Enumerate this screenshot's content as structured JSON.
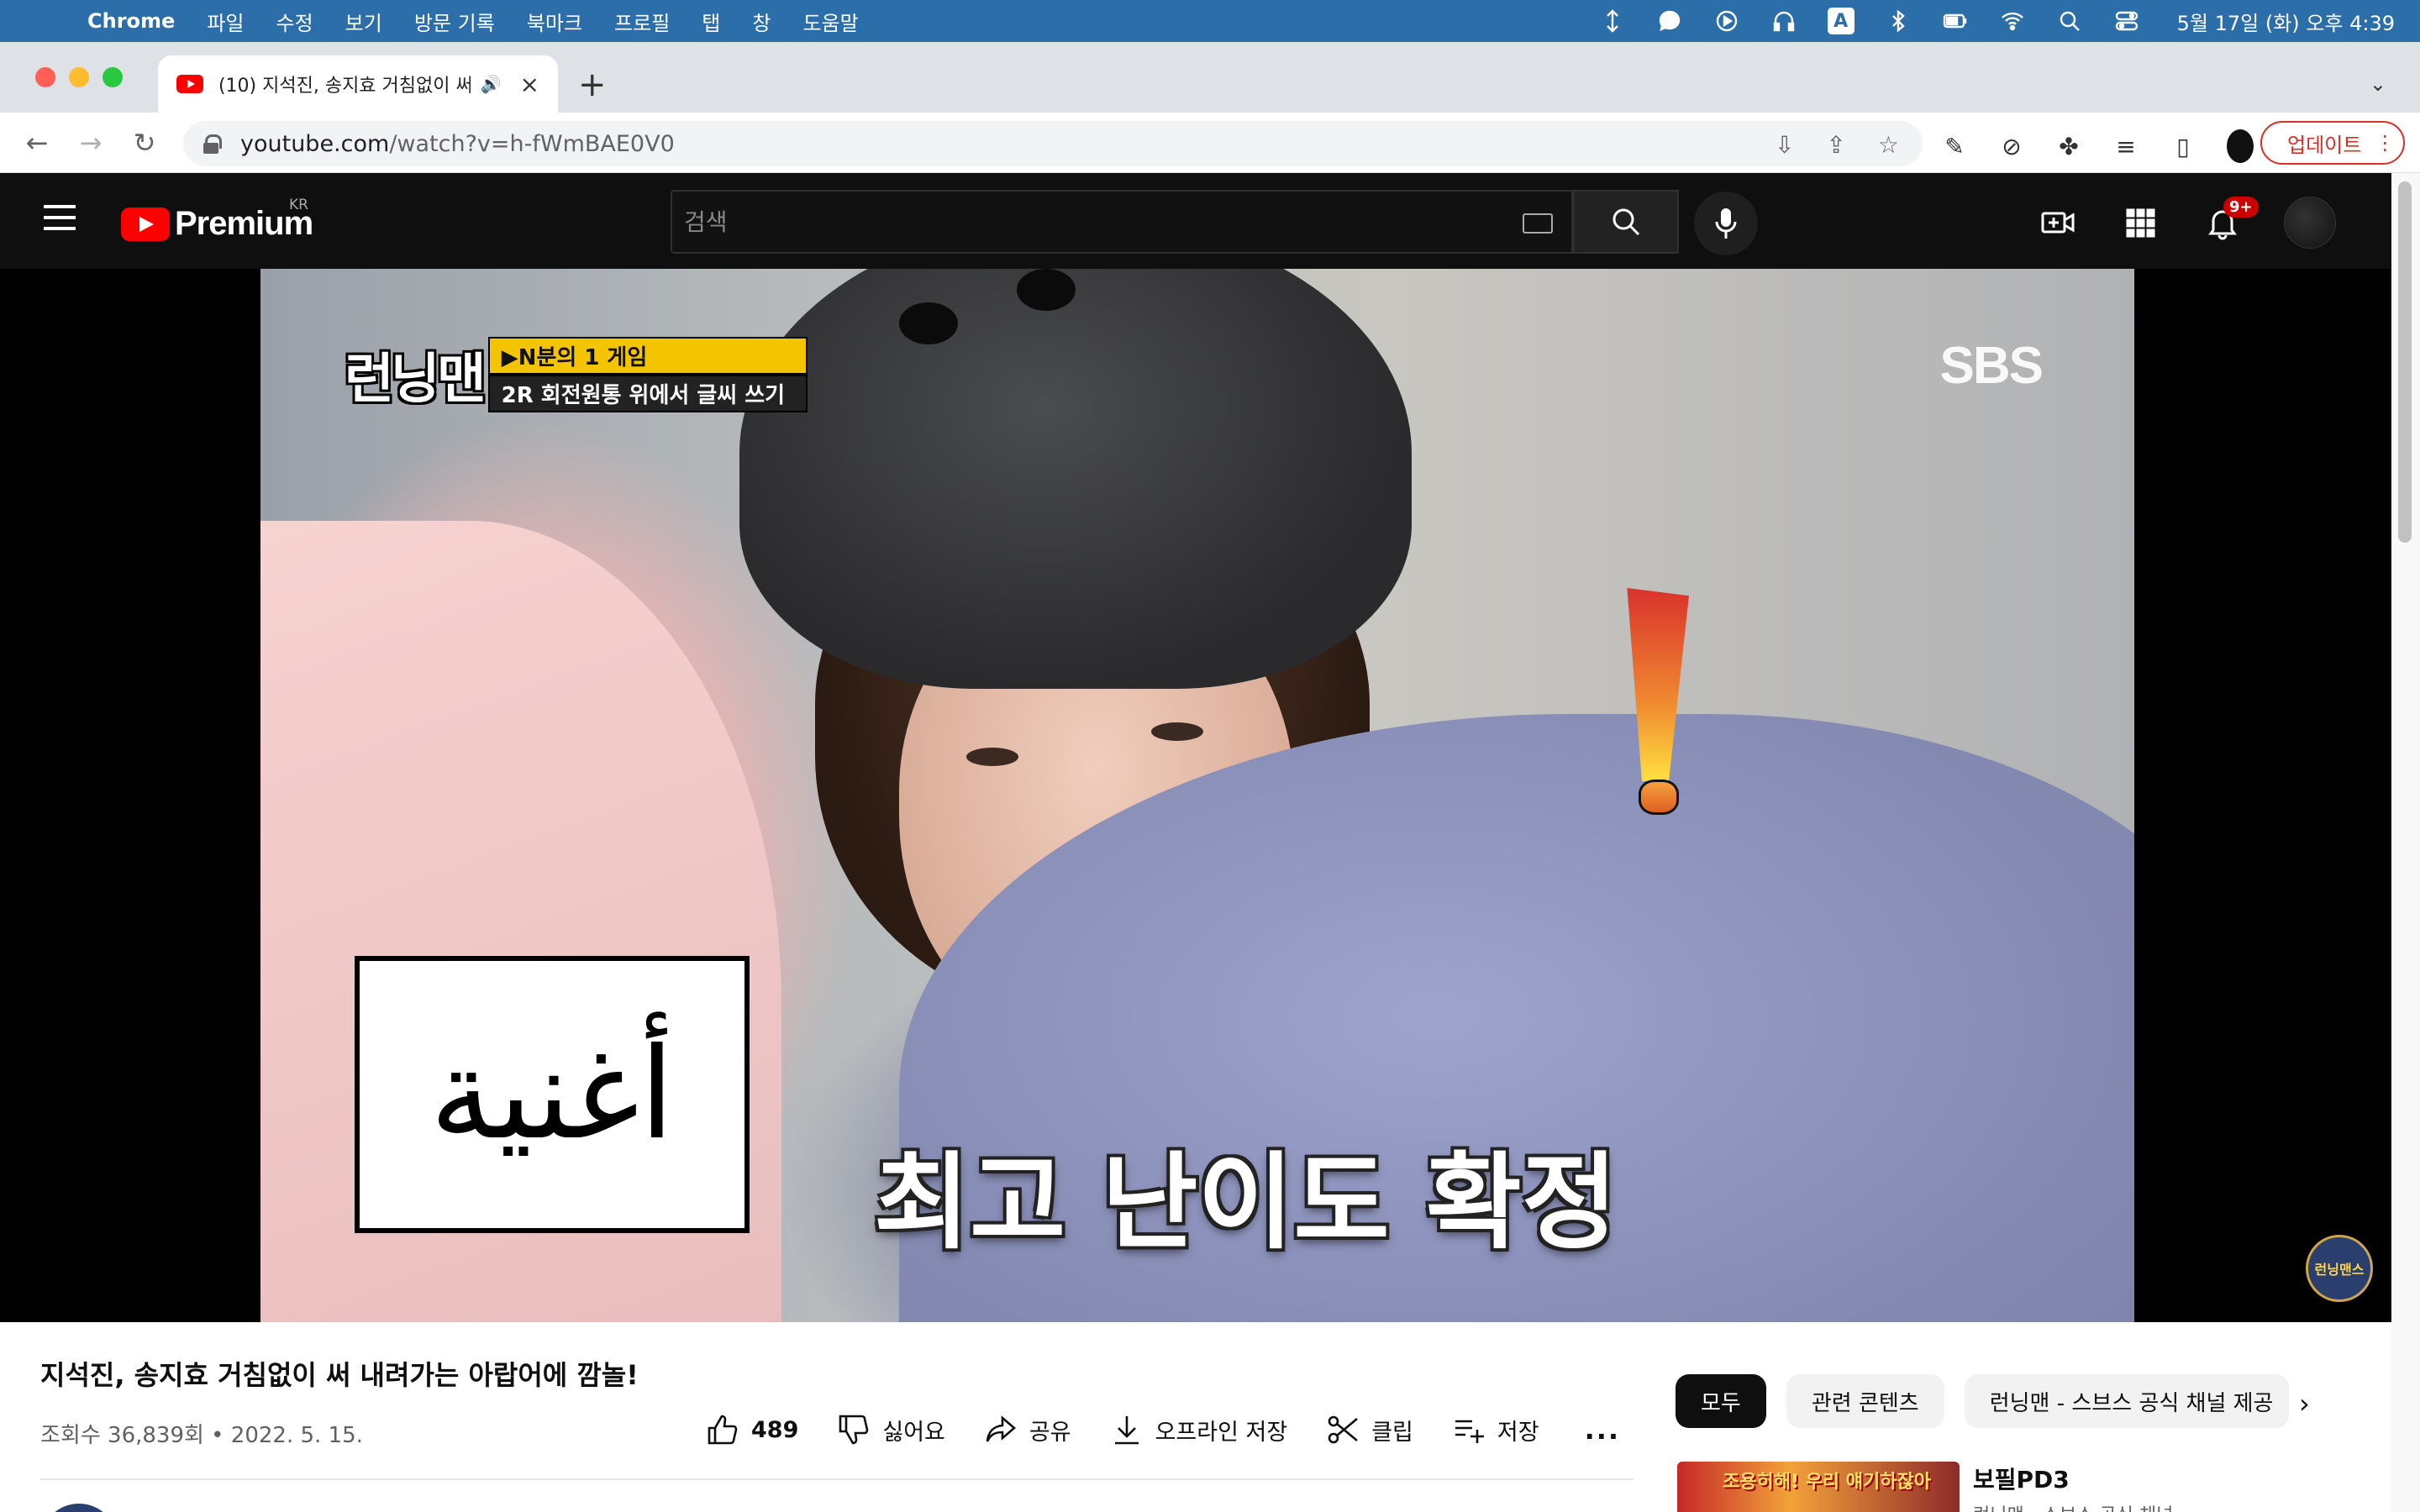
{
  "menubar": {
    "app_name": "Chrome",
    "items": [
      "파일",
      "수정",
      "보기",
      "방문 기록",
      "북마크",
      "프로필",
      "탭",
      "창",
      "도움말"
    ],
    "input_badge": "A",
    "clock": "5월 17일 (화) 오후 4:39"
  },
  "tab": {
    "title": "(10) 지석진, 송지효 거침없이 써",
    "close": "×",
    "new_tab": "+"
  },
  "toolbar": {
    "url_host": "youtube.com",
    "url_path": "/watch?v=h-fWmBAE0V0",
    "update_label": "업데이트"
  },
  "youtube": {
    "brand": "Premium",
    "region": "KR",
    "search_placeholder": "검색",
    "notification_count": "9+"
  },
  "video_frame": {
    "show_title": "런닝맨",
    "tag_line1": "▶N분의 1 게임",
    "tag_line2": "2R 회전원통 위에서 글씨 쓰기",
    "broadcaster": "SBS",
    "card_word": "أغنية",
    "subtitle": "최고 난이도 확정",
    "corner_badge": "런닝맨스"
  },
  "video": {
    "title": "지석진, 송지효 거침없이 써 내려가는 아랍어에 깜놀!",
    "meta": "조회수 36,839회 • 2022. 5. 15.",
    "likes": "489",
    "dislike": "싫어요",
    "share": "공유",
    "download": "오프라인 저장",
    "clip": "클립",
    "save": "저장",
    "more": "..."
  },
  "chips": [
    "모두",
    "관련 콘텐츠",
    "런닝맨 - 스브스 공식 채널 제공"
  ],
  "recommendation": {
    "thumb_text": "조용히해! 우리 얘기하잖아",
    "title": "보필PD3",
    "channel": "런닝맨 - 스브스 공식 채널"
  },
  "colors": {
    "menubar_bg": "#2b6ea9",
    "yt_dark": "#0f0f0f",
    "yt_red": "#ff0000",
    "update_red": "#d93025"
  }
}
